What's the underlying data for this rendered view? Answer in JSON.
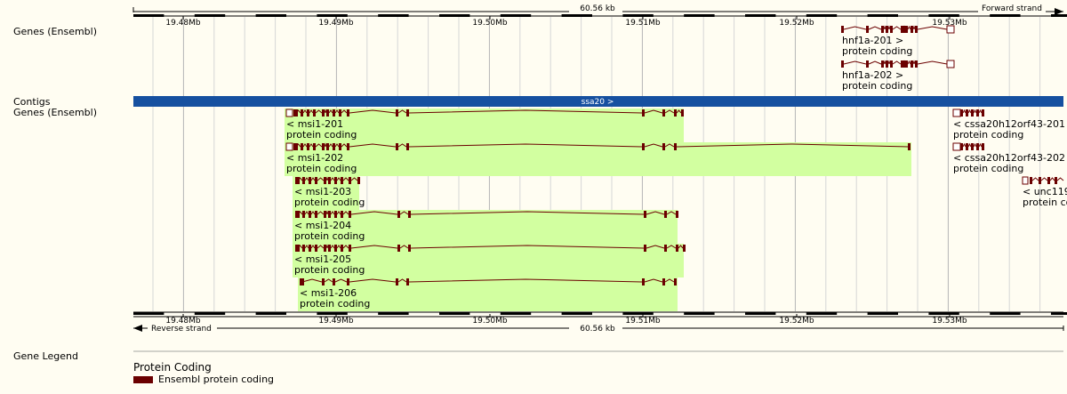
{
  "colors": {
    "background": "#fffdf2",
    "exon": "#6b0000",
    "intron": "#6b0000",
    "highlight": "#d2ffa0",
    "contig": "#1650a0",
    "gridline": "#c8c8c8",
    "ruler": "#000000"
  },
  "track_labels": {
    "genes_forward": "Genes (Ensembl)",
    "contigs": "Contigs",
    "genes_reverse": "Genes (Ensembl)",
    "legend": "Gene Legend"
  },
  "ruler": {
    "length_label": "60.56 kb",
    "forward_strand": "Forward strand",
    "reverse_strand": "Reverse strand",
    "ticks": [
      "19.48Mb",
      "19.49Mb",
      "19.50Mb",
      "19.51Mb",
      "19.52Mb",
      "19.53Mb"
    ]
  },
  "contig": {
    "label": "ssa20 >"
  },
  "genes_forward": [
    {
      "name": "hnf1a-201 >",
      "biotype": "protein coding"
    },
    {
      "name": "hnf1a-202 >",
      "biotype": "protein coding"
    }
  ],
  "genes_reverse": [
    {
      "name": "< msi1-201",
      "biotype": "protein coding"
    },
    {
      "name": "< msi1-202",
      "biotype": "protein coding"
    },
    {
      "name": "< msi1-203",
      "biotype": "protein coding"
    },
    {
      "name": "< msi1-204",
      "biotype": "protein coding"
    },
    {
      "name": "< msi1-205",
      "biotype": "protein coding"
    },
    {
      "name": "< msi1-206",
      "biotype": "protein coding"
    },
    {
      "name": "< cssa20h12orf43-201",
      "biotype": "protein coding"
    },
    {
      "name": "< cssa20h12orf43-202",
      "biotype": "protein coding"
    },
    {
      "name": "< unc119",
      "biotype": "protein coding"
    }
  ],
  "legend": {
    "category": "Protein Coding",
    "item": "Ensembl protein coding"
  }
}
